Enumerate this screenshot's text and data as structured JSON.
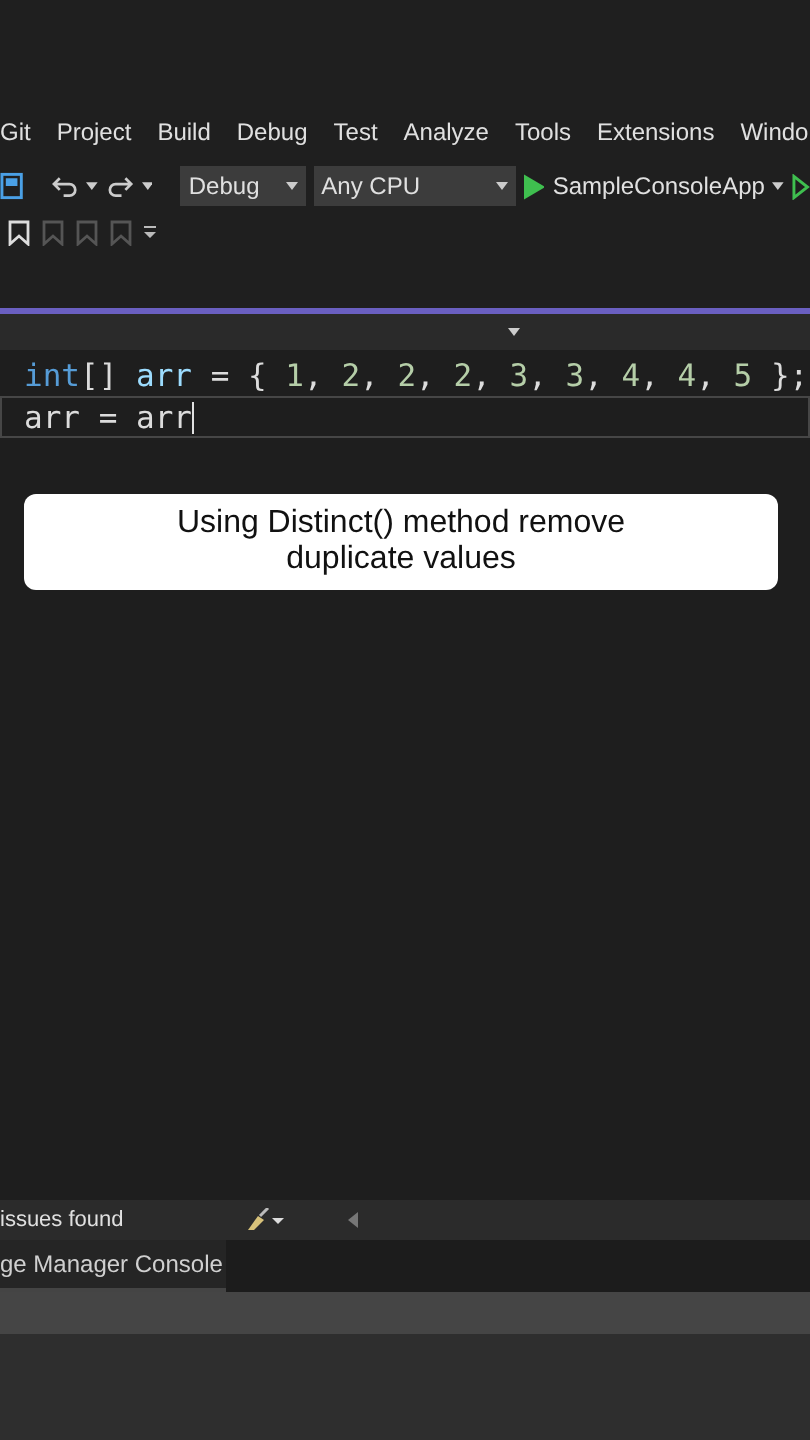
{
  "menu_bar": {
    "items": [
      "Git",
      "Project",
      "Build",
      "Debug",
      "Test",
      "Analyze",
      "Tools",
      "Extensions",
      "Windo"
    ]
  },
  "toolbar": {
    "configuration": "Debug",
    "platform": "Any CPU",
    "startup_project": "SampleConsoleApp"
  },
  "editor": {
    "lines": [
      {
        "current": false,
        "tokens": [
          {
            "kind": "keyword",
            "text": "int"
          },
          {
            "kind": "plain",
            "text": "[] "
          },
          {
            "kind": "variable",
            "text": "arr"
          },
          {
            "kind": "plain",
            "text": " = { "
          },
          {
            "kind": "number",
            "text": "1"
          },
          {
            "kind": "plain",
            "text": ", "
          },
          {
            "kind": "number",
            "text": "2"
          },
          {
            "kind": "plain",
            "text": ", "
          },
          {
            "kind": "number",
            "text": "2"
          },
          {
            "kind": "plain",
            "text": ", "
          },
          {
            "kind": "number",
            "text": "2"
          },
          {
            "kind": "plain",
            "text": ", "
          },
          {
            "kind": "number",
            "text": "3"
          },
          {
            "kind": "plain",
            "text": ", "
          },
          {
            "kind": "number",
            "text": "3"
          },
          {
            "kind": "plain",
            "text": ", "
          },
          {
            "kind": "number",
            "text": "4"
          },
          {
            "kind": "plain",
            "text": ", "
          },
          {
            "kind": "number",
            "text": "4"
          },
          {
            "kind": "plain",
            "text": ", "
          },
          {
            "kind": "number",
            "text": "5"
          },
          {
            "kind": "plain",
            "text": " };"
          }
        ]
      },
      {
        "current": true,
        "tokens": [
          {
            "kind": "plain",
            "text": "arr = arr"
          }
        ]
      }
    ]
  },
  "caption": "Using Distinct() method remove duplicate values",
  "status": {
    "issues": "issues found"
  },
  "bottom_tabs": [
    {
      "label": "ge Manager Console",
      "selected": true
    }
  ]
}
